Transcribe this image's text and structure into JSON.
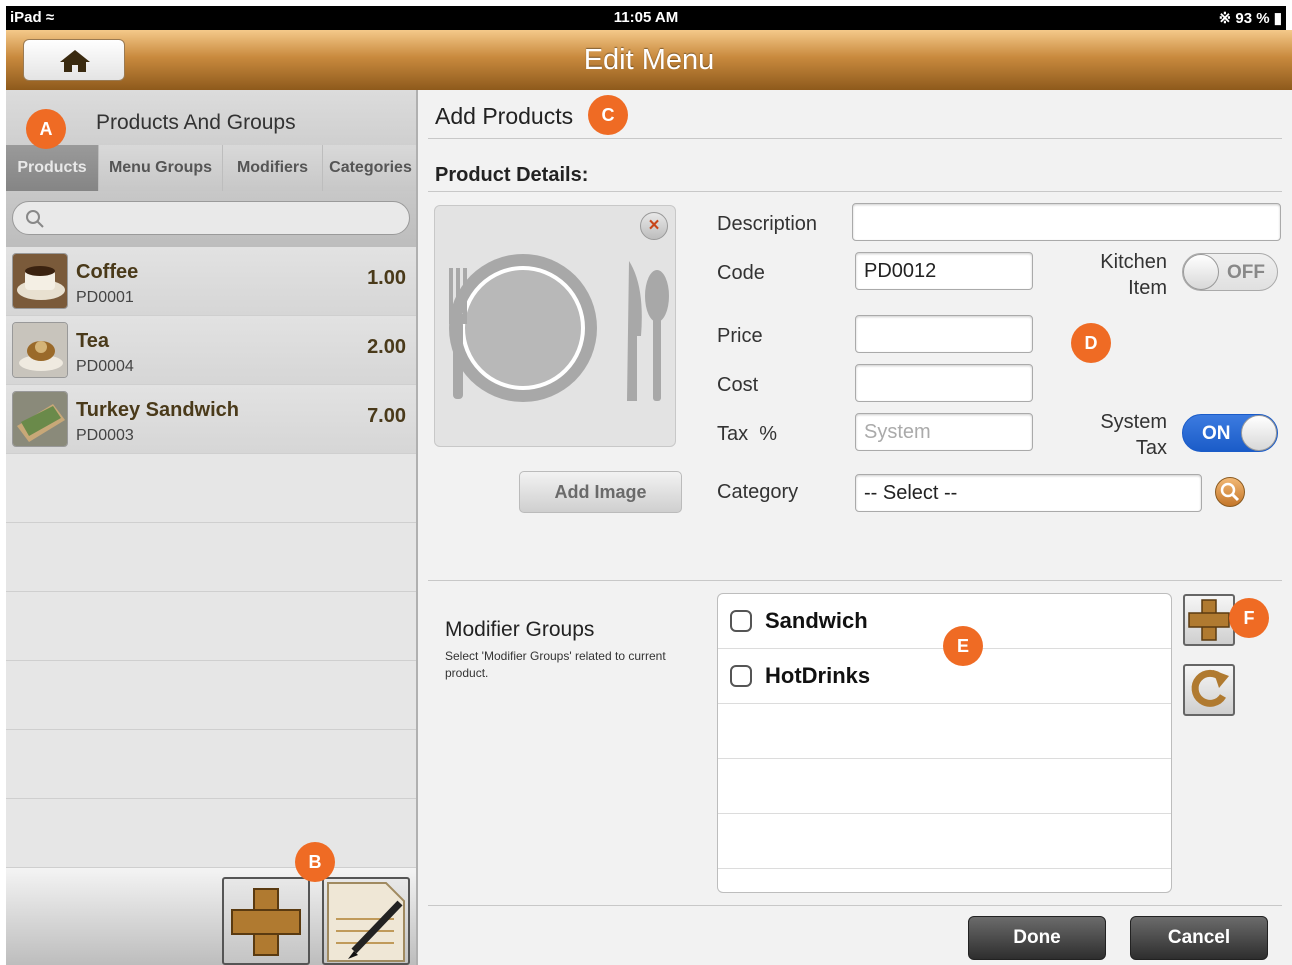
{
  "status_bar": {
    "device": "iPad",
    "time": "11:05 AM",
    "battery": "93 %"
  },
  "nav": {
    "title": "Edit Menu"
  },
  "left_panel": {
    "title": "Products And Groups",
    "tabs": [
      "Products",
      "Menu Groups",
      "Modifiers",
      "Categories"
    ],
    "active_tab": "Products",
    "products": [
      {
        "name": "Coffee",
        "code": "PD0001",
        "price": "1.00"
      },
      {
        "name": "Tea",
        "code": "PD0004",
        "price": "2.00"
      },
      {
        "name": "Turkey Sandwich",
        "code": "PD0003",
        "price": "7.00"
      }
    ]
  },
  "right_panel": {
    "heading": "Add Products",
    "section_label": "Product Details:",
    "add_image": "Add Image",
    "fields": {
      "description_label": "Description",
      "description_value": "",
      "code_label": "Code",
      "code_value": "PD0012",
      "price_label": "Price",
      "price_value": "",
      "cost_label": "Cost",
      "cost_value": "",
      "tax_label": "Tax  %",
      "tax_placeholder": "System",
      "category_label": "Category",
      "category_value": "-- Select --"
    },
    "kitchen_item": {
      "label_line1": "Kitchen",
      "label_line2": "Item",
      "state": "OFF"
    },
    "system_tax": {
      "label_line1": "System",
      "label_line2": "Tax",
      "state": "ON"
    },
    "modifier_groups": {
      "title": "Modifier Groups",
      "description": "Select 'Modifier Groups' related to current product.",
      "items": [
        {
          "name": "Sandwich",
          "checked": false
        },
        {
          "name": "HotDrinks",
          "checked": false
        }
      ]
    },
    "buttons": {
      "done": "Done",
      "cancel": "Cancel"
    }
  },
  "markers": [
    "A",
    "B",
    "C",
    "D",
    "E",
    "F"
  ],
  "colors": {
    "accent": "#ef6b24",
    "nav_brown": "#c98a3e",
    "switch_on": "#1b5cc8"
  }
}
